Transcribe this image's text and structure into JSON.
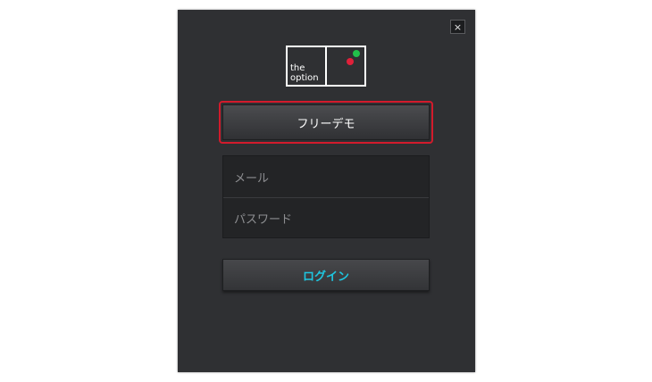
{
  "dialog": {
    "close_label": "×"
  },
  "logo": {
    "text": "the\noption",
    "dot_green_color": "#21c04a",
    "dot_red_color": "#e0203a"
  },
  "demo": {
    "label": "フリーデモ",
    "highlight_color": "#d21b2c"
  },
  "form": {
    "email_placeholder": "メール",
    "password_placeholder": "パスワード"
  },
  "login": {
    "label": "ログイン",
    "color": "#1ec6e0"
  }
}
